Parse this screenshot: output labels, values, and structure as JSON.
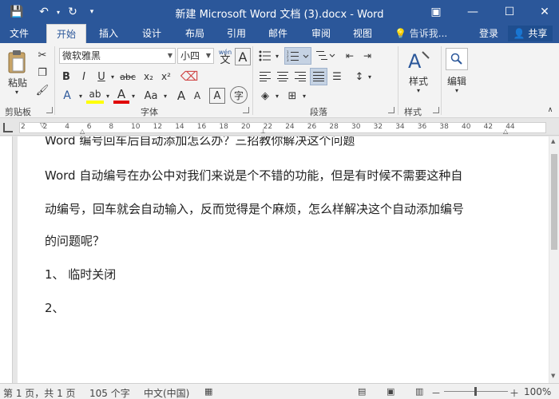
{
  "window": {
    "title": "新建 Microsoft Word 文档 (3).docx - Word",
    "controls": {
      "ribbon_options": "▣",
      "minimize": "—",
      "maximize": "☐",
      "close": "✕"
    }
  },
  "quick_access": {
    "save": "💾",
    "undo": "↶",
    "redo": "↻",
    "customize": "▾"
  },
  "tabs": [
    {
      "label": "文件",
      "active": false
    },
    {
      "label": "开始",
      "active": true
    },
    {
      "label": "插入",
      "active": false
    },
    {
      "label": "设计",
      "active": false
    },
    {
      "label": "布局",
      "active": false
    },
    {
      "label": "引用",
      "active": false
    },
    {
      "label": "邮件",
      "active": false
    },
    {
      "label": "审阅",
      "active": false
    },
    {
      "label": "视图",
      "active": false
    }
  ],
  "tell_me": "告诉我...",
  "signin": "登录",
  "share": "共享",
  "ribbon": {
    "clipboard": {
      "paste_label": "粘贴",
      "group_label": "剪贴板"
    },
    "font": {
      "font_name": "微软雅黑",
      "font_size": "小四",
      "wen": "wén",
      "wen_char": "文",
      "a_char": "A",
      "bold": "B",
      "italic": "I",
      "underline": "U",
      "strike": "abc",
      "sub": "x₂",
      "sup": "x²",
      "text_effects": "A",
      "highlight": "ab",
      "font_color": "A",
      "case": "Aa",
      "grow": "A",
      "shrink": "A",
      "char_border": "A",
      "enclose": "字",
      "group_label": "字体"
    },
    "paragraph": {
      "group_label": "段落"
    },
    "styles": {
      "button_label": "样式",
      "group_label": "样式"
    },
    "editing": {
      "button_label": "编辑"
    }
  },
  "ruler": {
    "ticks": [
      "2",
      "2",
      "4",
      "6",
      "8",
      "10",
      "12",
      "14",
      "16",
      "18",
      "20",
      "22",
      "24",
      "26",
      "28",
      "30",
      "32",
      "34",
      "36",
      "38",
      "40",
      "42",
      "44"
    ]
  },
  "document": {
    "lines": [
      "Word 编号回车后自动添加怎么办？三招教你解决这个问题",
      "Word 自动编号在办公中对我们来说是个不错的功能，但是有时候不需要这种自",
      "动编号，回车就会自动输入，反而觉得是个麻烦，怎么样解决这个自动添加编号",
      "的问题呢？",
      "1、      临时关闭",
      "2、"
    ]
  },
  "statusbar": {
    "page": "第 1 页，共 1 页",
    "words": "105 个字",
    "language": "中文(中国)",
    "zoom": "100%",
    "zoom_minus": "－",
    "zoom_plus": "＋"
  }
}
